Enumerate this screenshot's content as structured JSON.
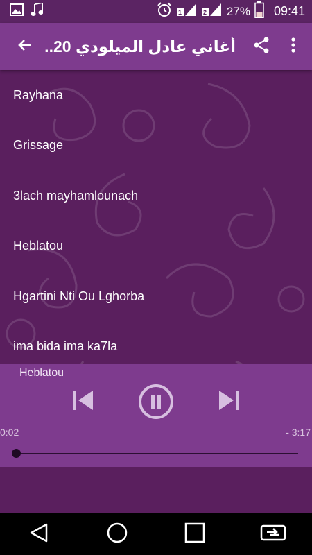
{
  "status_bar": {
    "battery": "27%",
    "time": "09:41",
    "icons": [
      "image-icon",
      "music-note-icon",
      "alarm-icon",
      "signal-sim1-icon",
      "signal-sim2-icon",
      "battery-icon"
    ]
  },
  "toolbar": {
    "title": "أغاني عادل الميلودي 20...",
    "icons": [
      "back-arrow-icon",
      "share-icon",
      "more-vert-icon"
    ]
  },
  "songs": [
    {
      "title": "Rayhana"
    },
    {
      "title": "Grissage"
    },
    {
      "title": "3lach mayhamlounach"
    },
    {
      "title": "Heblatou"
    },
    {
      "title": "Hgartini Nti Ou Lghorba"
    },
    {
      "title": "ima bida ima ka7la"
    }
  ],
  "player": {
    "now_playing": "Heblatou",
    "elapsed": "0:02",
    "remaining": "- 3:17",
    "progress": 0.0,
    "state": "playing",
    "icons": [
      "skip-previous-icon",
      "pause-icon",
      "skip-next-icon"
    ]
  },
  "nav_bar": {
    "icons": [
      "nav-back-icon",
      "nav-home-icon",
      "nav-recents-icon",
      "screen-cast-icon"
    ]
  },
  "colors": {
    "status_bar": "#5b2463",
    "toolbar": "#7e3b8e",
    "background": "#5a1f5e",
    "player_bar": "#7e3b8e",
    "text": "#ffffff",
    "battery_fill": "#f2d4d0"
  }
}
